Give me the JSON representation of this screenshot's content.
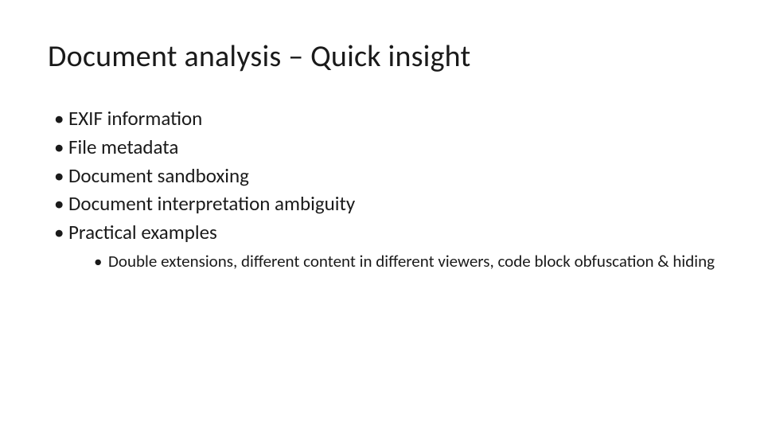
{
  "slide": {
    "title": "Document analysis – Quick insight",
    "bullets": [
      "EXIF information",
      "File metadata",
      "Document sandboxing",
      "Document interpretation ambiguity",
      "Practical examples"
    ],
    "sub_bullet": "Double extensions, different content in different viewers, code block obfuscation & hiding"
  }
}
